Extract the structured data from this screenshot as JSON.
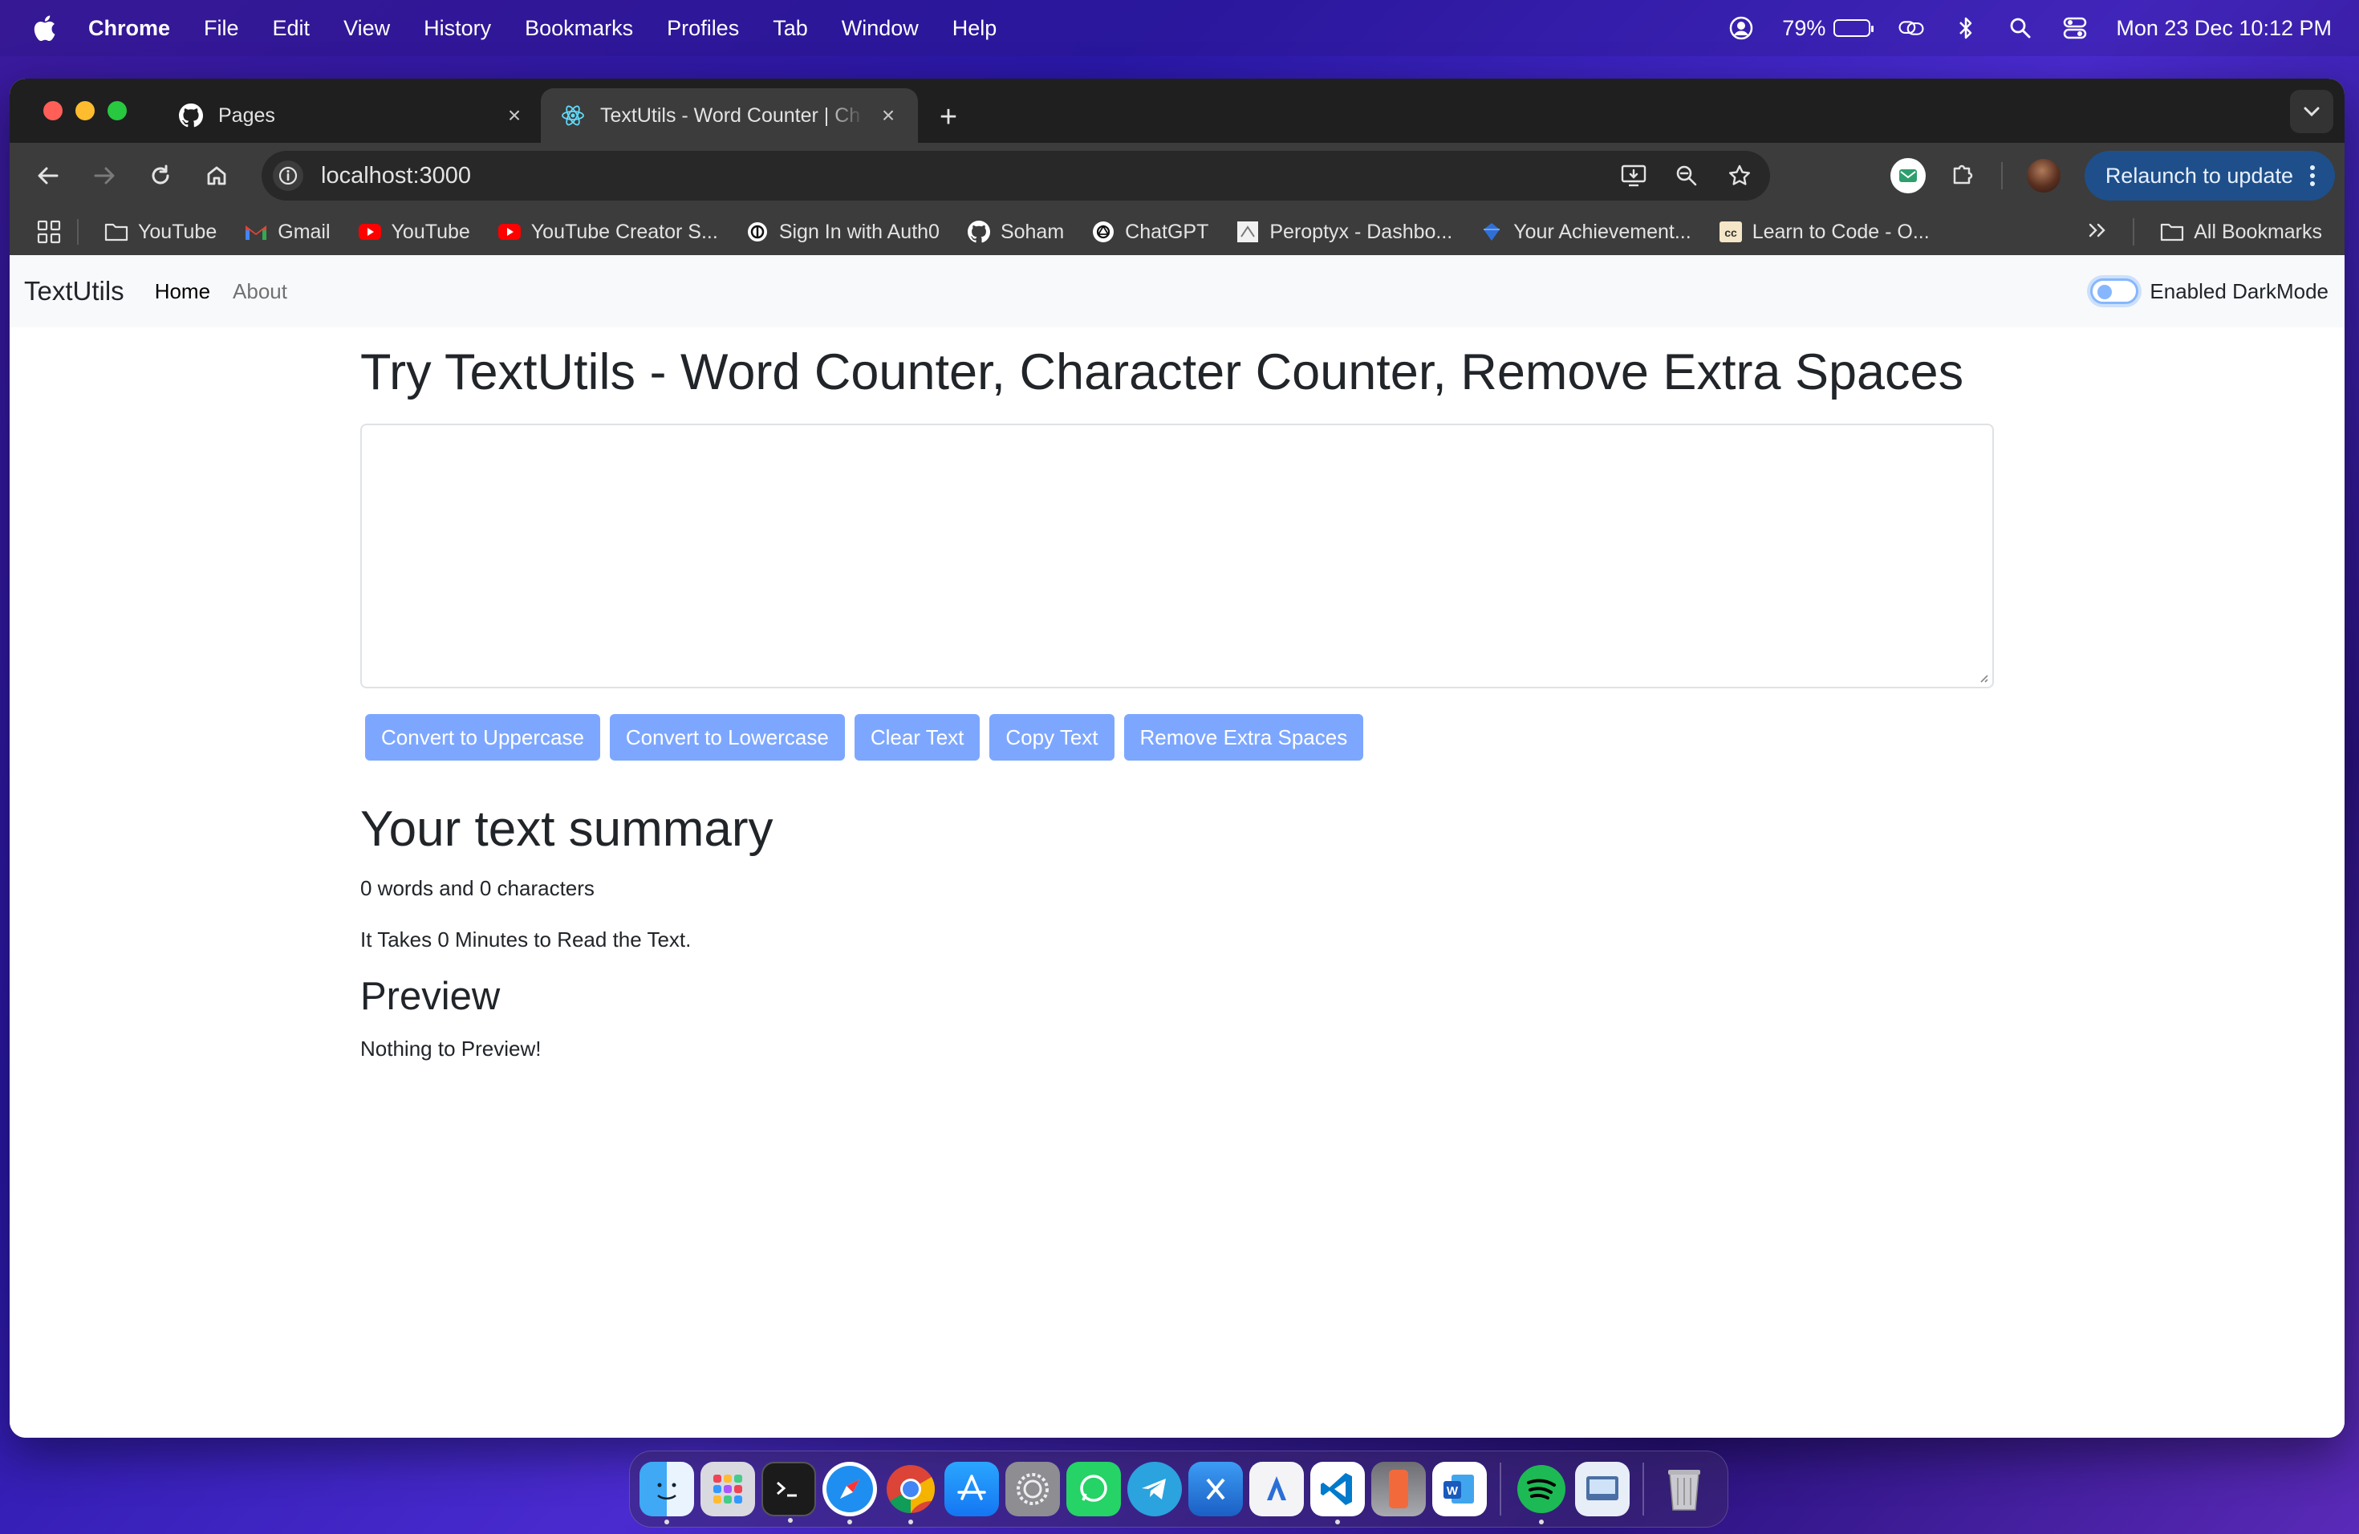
{
  "menubar": {
    "app_name": "Chrome",
    "items": [
      "File",
      "Edit",
      "View",
      "History",
      "Bookmarks",
      "Profiles",
      "Tab",
      "Window",
      "Help"
    ],
    "battery_percent": "79%",
    "battery_level": 0.79,
    "datetime": "Mon 23 Dec  10:12 PM"
  },
  "browser": {
    "tabs": [
      {
        "title": "Pages",
        "favicon": "github-icon",
        "active": false
      },
      {
        "title": "TextUtils - Word Counter | Ch",
        "favicon": "react-icon",
        "active": true
      }
    ],
    "url": "localhost:3000",
    "relaunch_label": "Relaunch to update",
    "bookmarks": [
      {
        "label": "YouTube",
        "icon": "folder-icon"
      },
      {
        "label": "Gmail",
        "icon": "gmail-icon"
      },
      {
        "label": "YouTube",
        "icon": "youtube-icon"
      },
      {
        "label": "YouTube Creator S...",
        "icon": "youtube-icon"
      },
      {
        "label": "Sign In with Auth0",
        "icon": "auth0-icon"
      },
      {
        "label": "Soham",
        "icon": "github-icon"
      },
      {
        "label": "ChatGPT",
        "icon": "chatgpt-icon"
      },
      {
        "label": "Peroptyx - Dashbo...",
        "icon": "peroptyx-icon"
      },
      {
        "label": "Your Achievement...",
        "icon": "achievement-icon"
      },
      {
        "label": "Learn to Code - O...",
        "icon": "freecodecamp-icon"
      }
    ],
    "all_bookmarks_label": "All Bookmarks"
  },
  "page": {
    "brand": "TextUtils",
    "nav": [
      {
        "label": "Home",
        "active": true
      },
      {
        "label": "About",
        "active": false
      }
    ],
    "darkmode_label": "Enabled DarkMode",
    "heading": "Try TextUtils - Word Counter, Character Counter, Remove Extra Spaces",
    "textarea_value": "",
    "buttons": [
      "Convert to Uppercase",
      "Convert to Lowercase",
      "Clear Text",
      "Copy Text",
      "Remove Extra Spaces"
    ],
    "summary_title": "Your text summary",
    "summary_counts": "0 words and 0 characters",
    "summary_read_time": "It Takes 0 Minutes to Read the Text.",
    "preview_title": "Preview",
    "preview_text": "Nothing to Preview!"
  },
  "dock": [
    "finder-icon",
    "launchpad-icon",
    "terminal-icon",
    "safari-icon",
    "chrome-icon",
    "app-store-icon",
    "system-settings-icon",
    "whatsapp-icon",
    "telegram-icon",
    "xcode-icon",
    "instruments-icon",
    "vscode-icon",
    "iphone-mirroring-icon",
    "word-icon",
    "spotify-icon",
    "preview-icon",
    "trash-icon"
  ],
  "colors": {
    "button_primary": "#7da7ff",
    "relaunch_bg": "#1e4f8a",
    "navbar_bg": "#f8f9fa"
  }
}
